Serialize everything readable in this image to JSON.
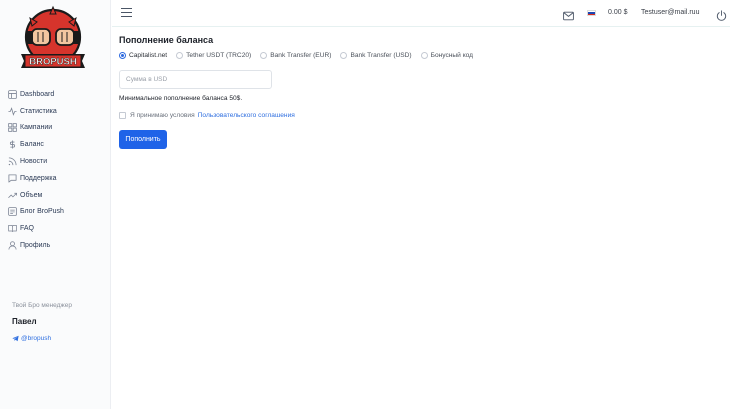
{
  "brand": {
    "logo_text": "BROPUSH"
  },
  "sidebar": {
    "items": [
      {
        "label": "Dashboard",
        "icon": "dashboard-icon"
      },
      {
        "label": "Статистика",
        "icon": "activity-icon"
      },
      {
        "label": "Кампании",
        "icon": "grid-icon"
      },
      {
        "label": "Баланс",
        "icon": "dollar-icon"
      },
      {
        "label": "Новости",
        "icon": "rss-icon"
      },
      {
        "label": "Поддержка",
        "icon": "chat-icon"
      },
      {
        "label": "Объем",
        "icon": "trending-up-icon"
      },
      {
        "label": "Блог BroPush",
        "icon": "blog-icon"
      },
      {
        "label": "FAQ",
        "icon": "book-icon"
      },
      {
        "label": "Профиль",
        "icon": "user-icon"
      }
    ],
    "manager": {
      "caption": "Твой Бро менеджер",
      "name": "Павел",
      "telegram": "@bropush"
    }
  },
  "header": {
    "balance": "0.00 $",
    "email": "Testuser@mail.ruu",
    "locale_flag": "ru"
  },
  "main": {
    "title": "Пополнение баланса",
    "payment_methods": [
      {
        "label": "Capitalist.net",
        "checked": true
      },
      {
        "label": "Tether USDT (TRC20)",
        "checked": false
      },
      {
        "label": "Bank Transfer (EUR)",
        "checked": false
      },
      {
        "label": "Bank Transfer (USD)",
        "checked": false
      },
      {
        "label": "Бонусный код",
        "checked": false
      }
    ],
    "amount_placeholder": "Сумма в USD",
    "amount_value": "",
    "min_note": "Минимальное пополнение баланса 50$.",
    "agree_text": "Я принимаю условия",
    "agree_link": "Пользовательского соглашения",
    "submit_label": "Пополнить"
  },
  "colors": {
    "accent": "#1f63e8",
    "link": "#2f6fe0",
    "logo_red": "#d6342c",
    "logo_dark": "#1a1a1a"
  }
}
